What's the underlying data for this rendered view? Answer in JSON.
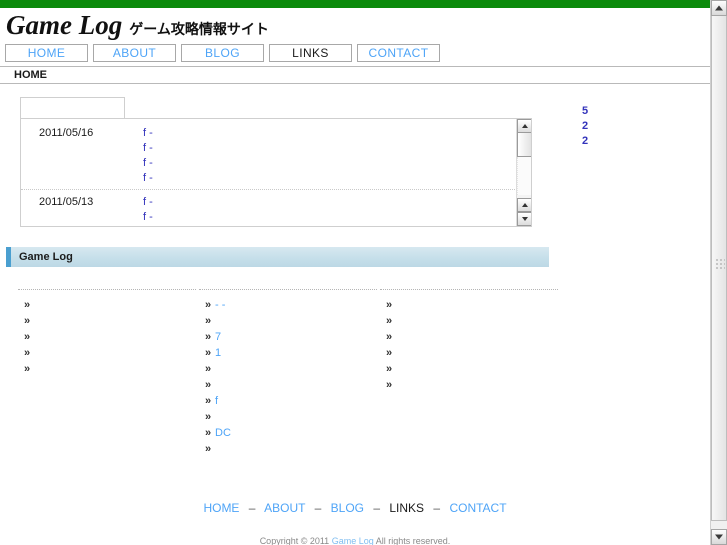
{
  "site": {
    "logo_main": "Game Log",
    "logo_sub": "ゲーム攻略情報サイト",
    "accent_green": "#0b8a0b",
    "link_blue": "#4ea4f7",
    "news_link_blue": "#3333bb",
    "section_accent": "#4a9fd0"
  },
  "nav": {
    "items": [
      {
        "label": "HOME",
        "active": false
      },
      {
        "label": "ABOUT",
        "active": false
      },
      {
        "label": "BLOG",
        "active": false
      },
      {
        "label": "LINKS",
        "active": true
      },
      {
        "label": "CONTACT",
        "active": false
      }
    ]
  },
  "breadcrumb": {
    "label": "HOME"
  },
  "news_panel": {
    "tab_label": "",
    "groups": [
      {
        "date": "2011/05/16",
        "entries": [
          {
            "text": "f -"
          },
          {
            "text": "f -"
          },
          {
            "text": "f -"
          },
          {
            "text": "f -"
          }
        ]
      },
      {
        "date": "2011/05/13",
        "entries": [
          {
            "text": "f -"
          },
          {
            "text": "f -"
          }
        ]
      }
    ],
    "scrollbar": {
      "up_icon": "triangle-up-icon",
      "down_icon": "triangle-down-icon"
    }
  },
  "side_counters": {
    "values": [
      "5",
      "2",
      "2"
    ]
  },
  "section": {
    "title": "Game Log"
  },
  "link_columns": [
    {
      "items": [
        {
          "marker": "»",
          "text": ""
        },
        {
          "marker": "»",
          "text": ""
        },
        {
          "marker": "»",
          "text": ""
        },
        {
          "marker": "»",
          "text": ""
        },
        {
          "marker": "»",
          "text": ""
        }
      ]
    },
    {
      "items": [
        {
          "marker": "»",
          "text": "-      -"
        },
        {
          "marker": "»",
          "text": ""
        },
        {
          "marker": "»",
          "text": "7"
        },
        {
          "marker": "»",
          "text": "      1"
        },
        {
          "marker": "»",
          "text": ""
        },
        {
          "marker": "»",
          "text": ""
        },
        {
          "marker": "»",
          "text": "      f"
        },
        {
          "marker": "»",
          "text": ""
        },
        {
          "marker": "»",
          "text": "       DC"
        },
        {
          "marker": "»",
          "text": ""
        }
      ]
    },
    {
      "items": [
        {
          "marker": "»",
          "text": ""
        },
        {
          "marker": "»",
          "text": ""
        },
        {
          "marker": "»",
          "text": ""
        },
        {
          "marker": "»",
          "text": ""
        },
        {
          "marker": "»",
          "text": ""
        },
        {
          "marker": "»",
          "text": ""
        }
      ]
    }
  ],
  "footer": {
    "links": [
      {
        "label": "HOME",
        "active": false
      },
      {
        "label": "ABOUT",
        "active": false
      },
      {
        "label": "BLOG",
        "active": false
      },
      {
        "label": "LINKS",
        "active": true
      },
      {
        "label": "CONTACT",
        "active": false
      }
    ],
    "separator": "–",
    "copyright_prefix": "Copyright © 2011",
    "copyright_link": "Game Log",
    "copyright_suffix": "All rights reserved."
  },
  "browser_scrollbar": {
    "up_icon": "triangle-up-icon",
    "down_icon": "triangle-down-icon"
  }
}
